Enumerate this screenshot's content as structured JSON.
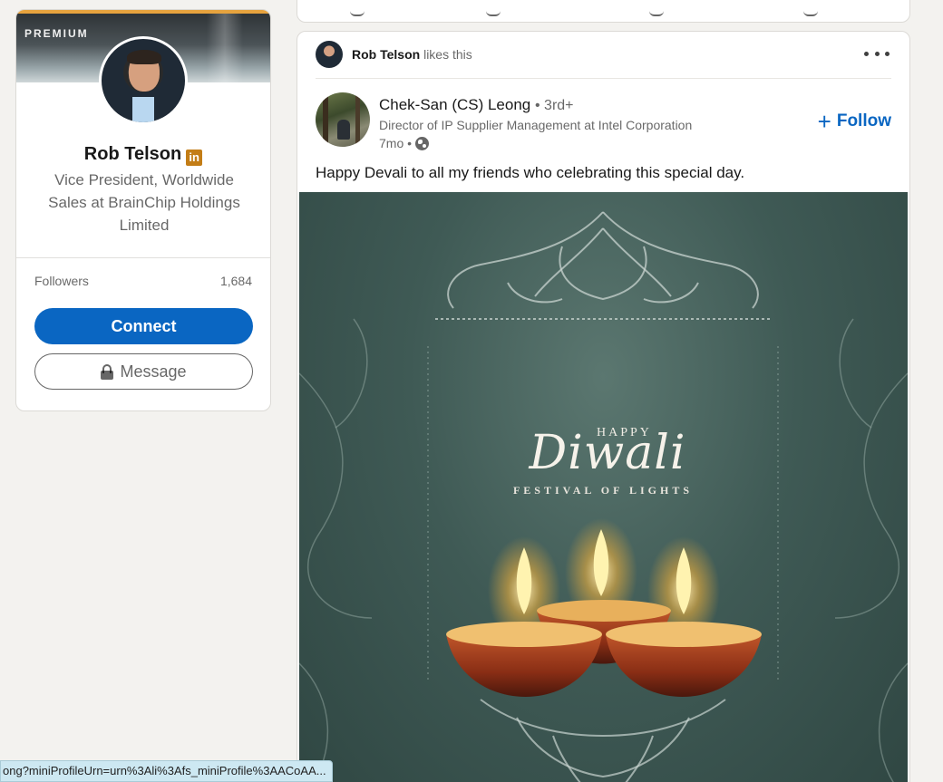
{
  "profile": {
    "badge": "PREMIUM",
    "name": "Rob Telson",
    "linkedin_badge": "in",
    "headline": "Vice President, Worldwide Sales at BrainChip Holdings Limited",
    "followers_label": "Followers",
    "followers_count": "1,684",
    "connect_label": "Connect",
    "message_label": "Message"
  },
  "post": {
    "social_name": "Rob Telson",
    "social_action": "likes this",
    "author_name": "Chek-San (CS) Leong",
    "author_degree": "• 3rd+",
    "author_headline": "Director of IP Supplier Management at Intel Corporation",
    "post_age": "7mo •",
    "follow_label": "Follow",
    "text": "Happy Devali to all my friends who celebrating this special day.",
    "image": {
      "happy": "HAPPY",
      "word": "Diwali",
      "subtitle": "FESTIVAL OF LIGHTS"
    }
  },
  "status_bar": {
    "url": "ong?miniProfileUrn=urn%3Ali%3Afs_miniProfile%3AACoAA..."
  },
  "colors": {
    "brand": "#0a66c2",
    "premium_gold": "#e7a33e",
    "page_bg": "#f3f2ef",
    "image_bg": "#3f5a55"
  },
  "icons": [
    "linkedin-icon",
    "lock-icon",
    "more-icon",
    "globe-icon",
    "plus-icon"
  ]
}
